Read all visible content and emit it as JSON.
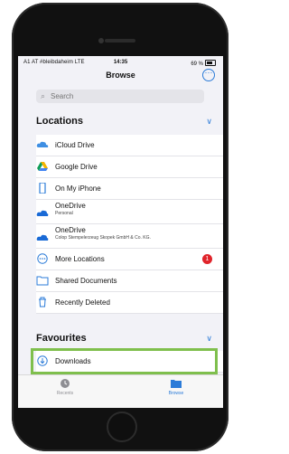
{
  "status": {
    "carrier": "A1 AT #bleibdaheim",
    "network": "LTE",
    "time": "14:35",
    "battery": "69 %"
  },
  "header": {
    "title": "Browse",
    "more_icon": "ellipsis-circle-icon"
  },
  "search": {
    "placeholder": "Search"
  },
  "locations": {
    "title": "Locations",
    "items": [
      {
        "label": "iCloud Drive",
        "icon": "icloud-icon"
      },
      {
        "label": "Google Drive",
        "icon": "google-drive-icon"
      },
      {
        "label": "On My iPhone",
        "icon": "iphone-icon"
      },
      {
        "label": "OneDrive",
        "sub": "Personal",
        "icon": "onedrive-icon"
      },
      {
        "label": "OneDrive",
        "sub": "Colop Stempelerzeug Skopek GmbH & Co. KG.",
        "icon": "onedrive-icon"
      },
      {
        "label": "More Locations",
        "badge": "1",
        "icon": "ellipsis-icon"
      },
      {
        "label": "Shared Documents",
        "icon": "folder-icon"
      },
      {
        "label": "Recently Deleted",
        "icon": "trash-icon"
      }
    ]
  },
  "favourites": {
    "title": "Favourites",
    "items": [
      {
        "label": "Downloads",
        "icon": "download-icon"
      }
    ]
  },
  "tabbar": {
    "tabs": [
      {
        "label": "Recents",
        "icon": "clock-icon"
      },
      {
        "label": "Browse",
        "icon": "folder-icon",
        "active": true
      }
    ]
  },
  "colors": {
    "accent": "#2b7bd8",
    "highlight": "#7fbf4d",
    "badge": "#e0242b"
  }
}
